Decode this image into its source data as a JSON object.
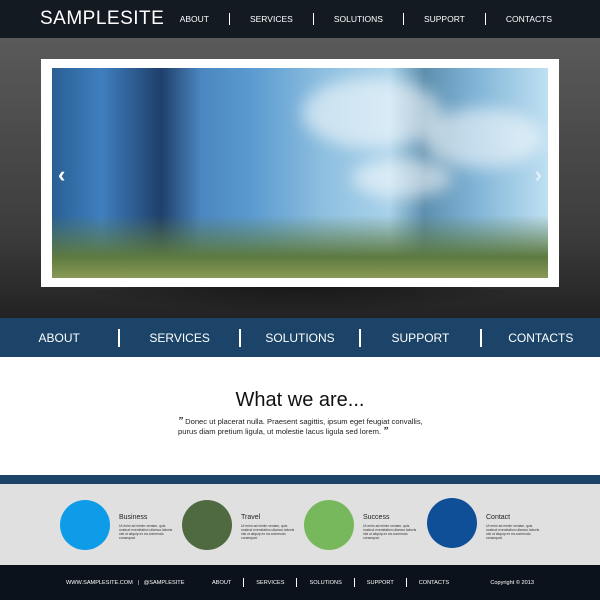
{
  "header": {
    "logo": "SAMPLESITE",
    "nav": [
      "ABOUT",
      "SERVICES",
      "SOLUTIONS",
      "SUPPORT",
      "CONTACTS"
    ]
  },
  "slider": {
    "prev_icon": "chevron-left-icon",
    "next_icon": "chevron-right-icon",
    "prev": "‹",
    "next": "›"
  },
  "main_nav": [
    "ABOUT",
    "SERVICES",
    "SOLUTIONS",
    "SUPPORT",
    "CONTACTS"
  ],
  "intro": {
    "title": "What we are...",
    "open_quote": "”",
    "close_quote": "”",
    "text": "Donec ut placerat nulla. Praesent sagittis, ipsum eget feugiat convallis, purus diam pretium ligula, ut molestie lacus ligula sed lorem."
  },
  "features": [
    {
      "title": "Business",
      "color": "#0e9be8",
      "text": "Ut enim ad minim veniam, quis nostrud exercitation ullamco laboris nisi ut aliquip ex ea commodo consequat."
    },
    {
      "title": "Travel",
      "color": "#4f6a40",
      "text": "Ut enim ad minim veniam, quis nostrud exercitation ullamco laboris nisi ut aliquip ex ea commodo consequat."
    },
    {
      "title": "Success",
      "color": "#78b85c",
      "text": "Ut enim ad minim veniam, quis nostrud exercitation ullamco laboris nisi ut aliquip ex ea commodo consequat."
    },
    {
      "title": "Contact",
      "color": "#0f4f98",
      "text": "Ut enim ad minim veniam, quis nostrud exercitation ullamco laboris nisi ut aliquip ex ea commodo consequat."
    }
  ],
  "footer": {
    "site": "WWW.SAMPLESITE.COM",
    "divider": "|",
    "handle": "@SAMPLESITE",
    "nav": [
      "ABOUT",
      "SERVICES",
      "SOLUTIONS",
      "SUPPORT",
      "CONTACTS"
    ],
    "copyright": "Copyright © 2013"
  }
}
